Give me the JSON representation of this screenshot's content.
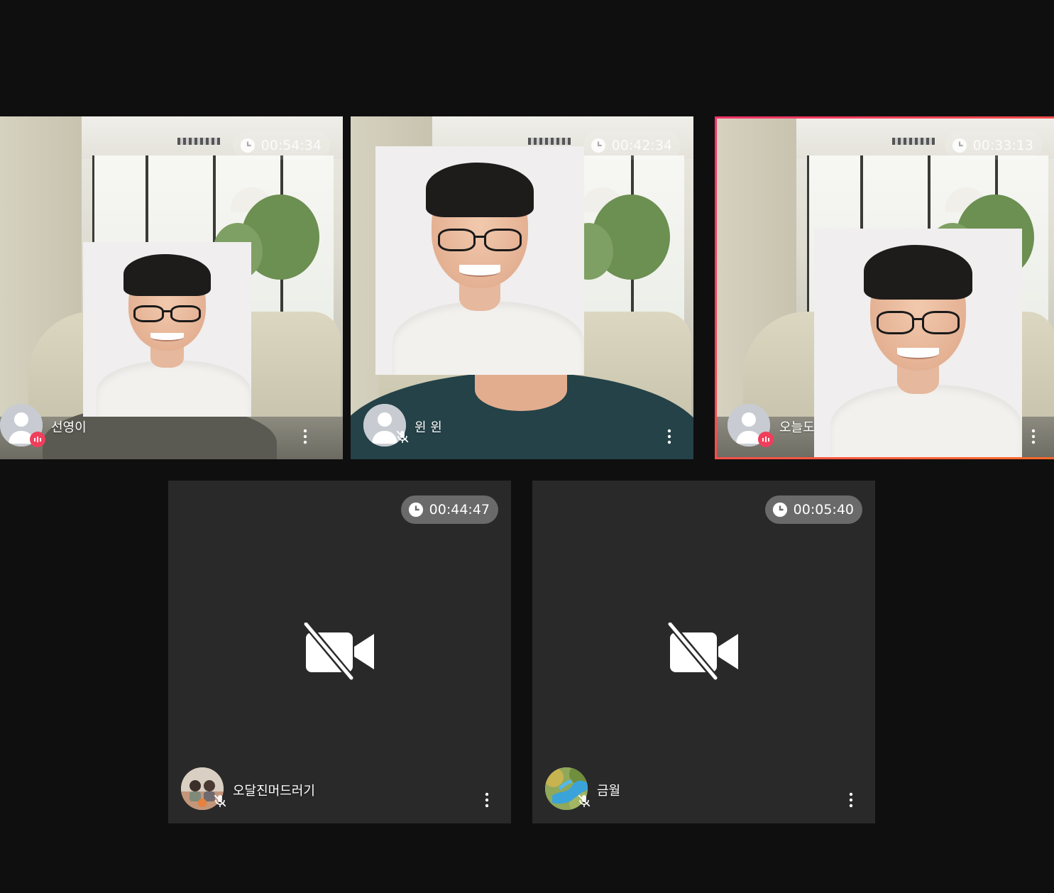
{
  "participants": [
    {
      "name": "선영이",
      "timer": "00:54:34",
      "video": true,
      "speaking": true,
      "muted": false,
      "active": false
    },
    {
      "name": "윈 윈",
      "timer": "00:42:34",
      "video": true,
      "speaking": false,
      "muted": true,
      "active": false
    },
    {
      "name": "오늘도",
      "timer": "00:33:13",
      "video": true,
      "speaking": true,
      "muted": false,
      "active": true
    },
    {
      "name": "오달진머드러기",
      "timer": "00:44:47",
      "video": false,
      "speaking": false,
      "muted": true,
      "active": false
    },
    {
      "name": "금월",
      "timer": "00:05:40",
      "video": false,
      "speaking": false,
      "muted": true,
      "active": false
    }
  ],
  "icons": {
    "timer": "clock-icon",
    "camera_off": "video-off-icon",
    "more": "more-vertical-icon",
    "speaking": "speaking-icon",
    "muted": "mic-off-icon"
  },
  "colors": {
    "background": "#0f0f0f",
    "tile": "#292929",
    "active_border_start": "#f5326a",
    "active_border_end": "#ff6a2a",
    "speaking_badge": "#f03e5b"
  }
}
